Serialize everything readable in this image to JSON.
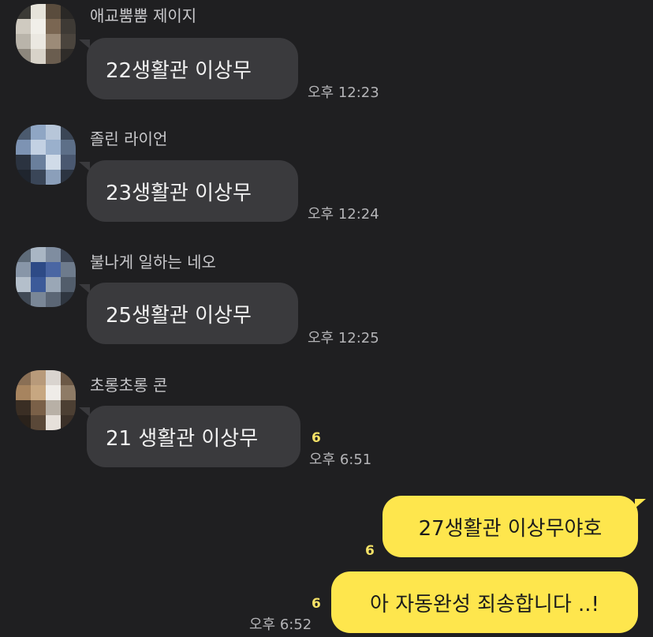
{
  "messages": [
    {
      "sender": "애교뿜뿜 제이지",
      "text": "22생활관 이상무",
      "time": "오후 12:23"
    },
    {
      "sender": "졸린 라이언",
      "text": "23생활관 이상무",
      "time": "오후 12:24"
    },
    {
      "sender": "불나게 일하는 네오",
      "text": "25생활관 이상무",
      "time": "오후 12:25"
    },
    {
      "sender": "초롱초롱 콘",
      "text": "21 생활관 이상무",
      "time": "오후 6:51",
      "unread": "6"
    }
  ],
  "my_messages": [
    {
      "text": "27생활관 이상무야호",
      "unread": "6"
    },
    {
      "text": "아 자동완성 죄송합니다 ..!",
      "unread": "6",
      "time": "오후 6:52"
    }
  ],
  "colors": {
    "background": "#1f1f21",
    "incoming_bubble": "#3a3a3d",
    "outgoing_bubble": "#fee64d",
    "unread_count": "#f5e267"
  }
}
